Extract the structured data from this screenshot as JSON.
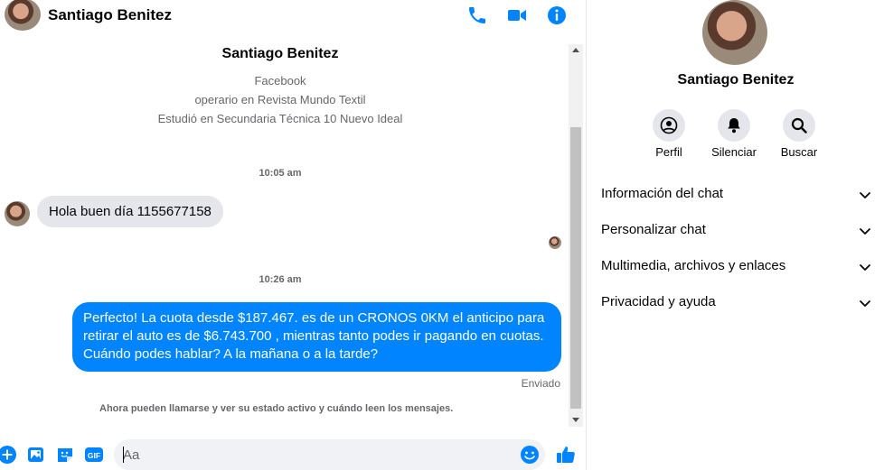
{
  "header": {
    "contact_name": "Santiago Benitez",
    "icons": [
      "phone-icon",
      "video-camera-icon",
      "info-icon"
    ]
  },
  "profile": {
    "name": "Santiago Benitez",
    "source": "Facebook",
    "work": "operario en Revista Mundo Textil",
    "education": "Estudió en Secundaria Técnica 10 Nuevo Ideal"
  },
  "messages": [
    {
      "time": "10:05 am",
      "direction": "incoming",
      "text": "Hola buen día 1155677158"
    },
    {
      "time": "10:26 am",
      "direction": "outgoing",
      "text": "Perfecto! La cuota desde $187.467. es de un CRONOS 0KM el anticipo para retirar el auto es de $6.743.700 , mientras tanto podes ir pagando en cuotas. Cuándo podes hablar? A la mañana o a la tarde?",
      "status": "Enviado"
    }
  ],
  "notice": "Ahora pueden llamarse y ver su estado activo y cuándo leen los mensajes.",
  "composer": {
    "placeholder": "Aa",
    "icons": [
      "add-icon",
      "photo-icon",
      "sticker-icon",
      "gif-icon",
      "emoji-icon",
      "thumbs-up-icon"
    ],
    "gif_label": "GIF"
  },
  "info_panel": {
    "name": "Santiago Benitez",
    "actions": [
      {
        "label": "Perfil",
        "icon": "profile-icon"
      },
      {
        "label": "Silenciar",
        "icon": "bell-icon"
      },
      {
        "label": "Buscar",
        "icon": "search-icon"
      }
    ],
    "sections": [
      {
        "label": "Información del chat"
      },
      {
        "label": "Personalizar chat"
      },
      {
        "label": "Multimedia, archivos y enlaces"
      },
      {
        "label": "Privacidad y ayuda"
      }
    ]
  },
  "colors": {
    "accent": "#0084ff",
    "incoming_bubble": "#e4e6eb",
    "secondary_text": "#65676b"
  }
}
